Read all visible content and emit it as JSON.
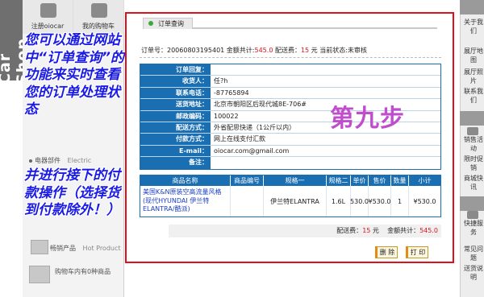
{
  "brand": {
    "vertical_title": "Car Shop"
  },
  "left": {
    "top_icons": [
      "注册oiocar",
      "我的购物车"
    ],
    "menu_items": [
      "电器部件",
      "Electric"
    ],
    "bottom_items": [
      "畅销产品",
      "Hot Product"
    ],
    "cart_text": "购物车内有0种商品"
  },
  "overlay": {
    "instruction_1": "您可以通过网站中“订单查询”的功能来实时查看您的订单处理状态",
    "instruction_2": "并进行接下的付款操作（选择货到付款除外！）",
    "step": "第九步"
  },
  "right": {
    "links": [
      "关于我们",
      "展厅地图",
      "展厅照片",
      "联系我们",
      "销售活动",
      "限时促销",
      "商城快讯",
      "快捷服务",
      "常见问题",
      "送货说明"
    ]
  },
  "order": {
    "tab_title": "订单查询",
    "summary_prefix": "订单号：20060803195401 金额共计:",
    "amount": "545.0",
    "shipping_label": " 配送费：",
    "shipping": "15",
    "summary_suffix": " 元  当前状态:未审核",
    "fields": [
      {
        "label": "订单回复：",
        "value": ""
      },
      {
        "label": "收货人：",
        "value": "任?h"
      },
      {
        "label": "联系电话：",
        "value": "-87765894"
      },
      {
        "label": "送货地址：",
        "value": "北京市朝阳区后现代城8E-706#"
      },
      {
        "label": "邮政编码：",
        "value": "100022"
      },
      {
        "label": "配送方式：",
        "value": "外省配思快递（1公斤以内）"
      },
      {
        "label": "付款方式：",
        "value": "网上在线支付汇款"
      },
      {
        "label": "E-mail：",
        "value": "oiocar.com@gmail.com"
      },
      {
        "label": "备注：",
        "value": ""
      }
    ],
    "product_columns": [
      "商品名称",
      "商品编号",
      "规格一",
      "规格二",
      "单价",
      "售价",
      "数量",
      "小计"
    ],
    "products": [
      {
        "name": "美国K&N原装空高流量风格(现代HYUNDAI 伊兰特ELANTRA/酷派)",
        "code": "",
        "spec1": "伊兰特ELANTRA",
        "spec2": "1.6L",
        "price": "530.0",
        "sale": "¥530.0",
        "qty": "1",
        "subtotal": "¥530.0"
      }
    ],
    "totals_shipping_label": "配送费：",
    "totals_shipping": "15",
    "totals_yuan": " 元",
    "totals_amount_label": "金额共计：",
    "totals_amount": "545.0",
    "delete_label": "删 除",
    "print_label": "打 印"
  }
}
